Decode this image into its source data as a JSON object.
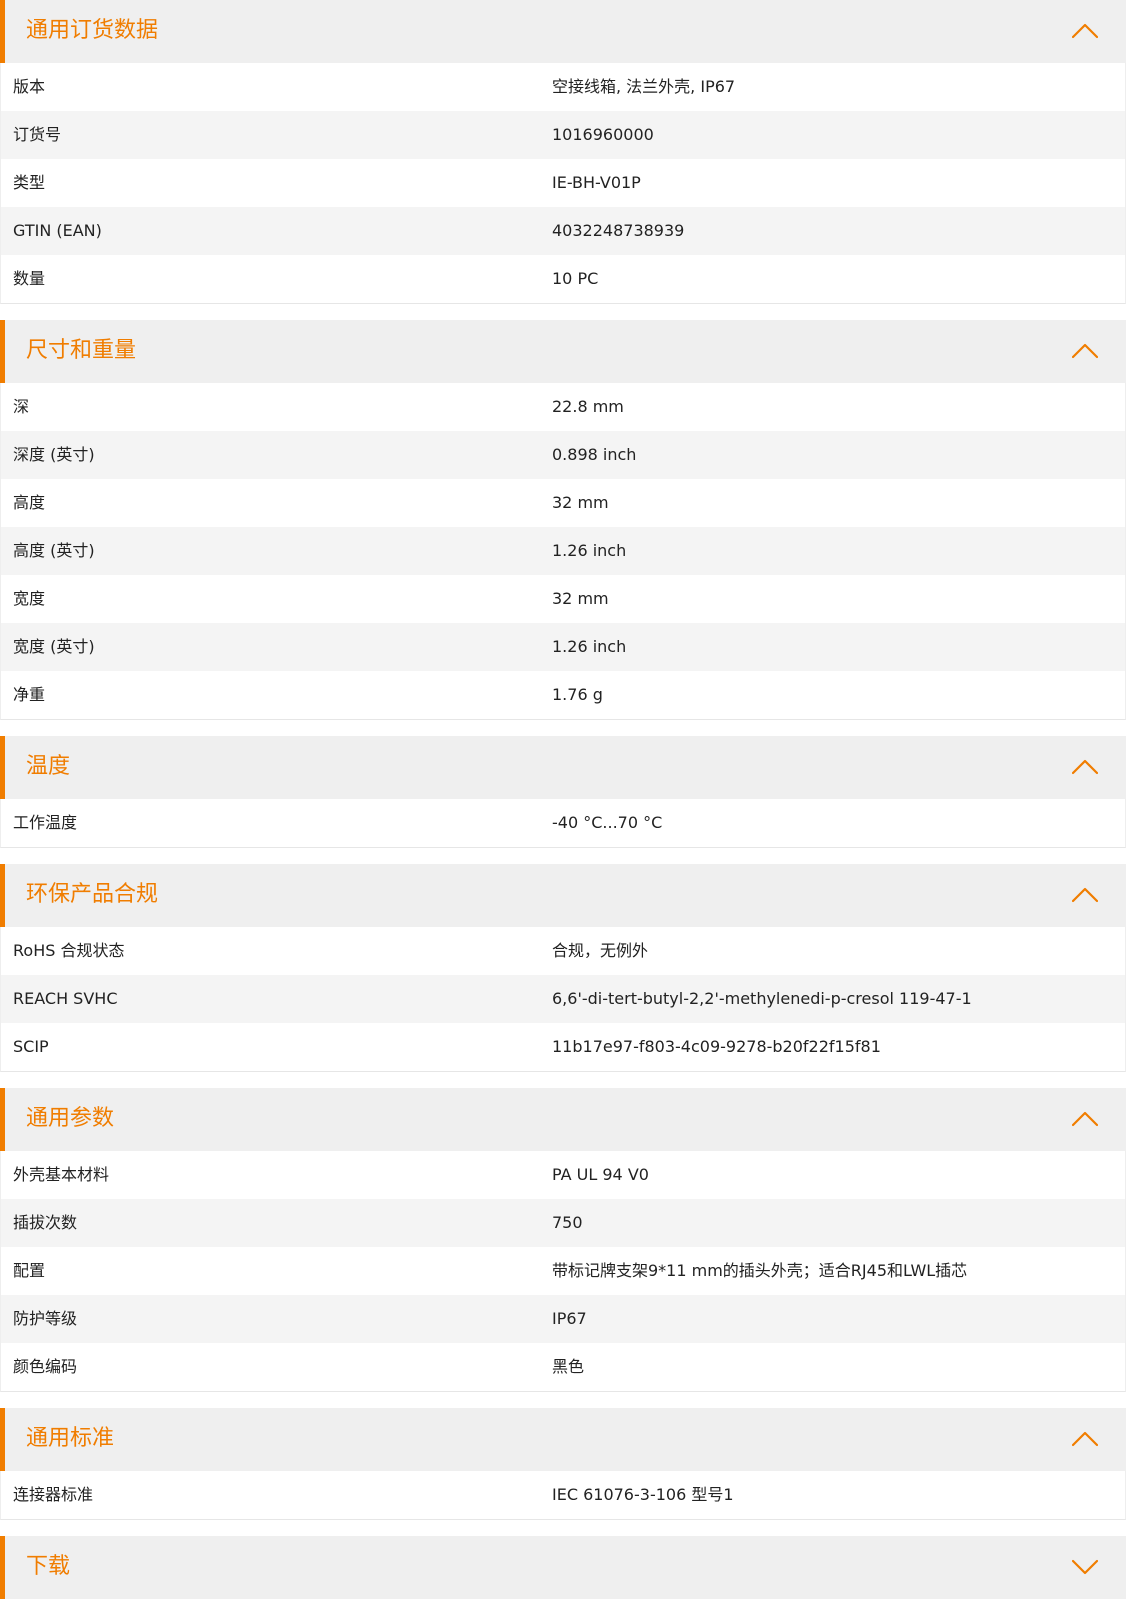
{
  "sections": [
    {
      "title": "通用订货数据",
      "rows": [
        {
          "label": "版本",
          "value": "空接线箱, 法兰外壳, IP67"
        },
        {
          "label": "订货号",
          "value": "1016960000"
        },
        {
          "label": "类型",
          "value": "IE-BH-V01P"
        },
        {
          "label": "GTIN (EAN)",
          "value": "4032248738939"
        },
        {
          "label": "数量",
          "value": "10  PC"
        }
      ]
    },
    {
      "title": "尺寸和重量",
      "rows": [
        {
          "label": "深",
          "value": "22.8  mm"
        },
        {
          "label": "深度 (英寸)",
          "value": "0.898  inch"
        },
        {
          "label": "高度",
          "value": "32  mm"
        },
        {
          "label": "高度 (英寸)",
          "value": "1.26  inch"
        },
        {
          "label": "宽度",
          "value": "32  mm"
        },
        {
          "label": "宽度 (英寸)",
          "value": "1.26  inch"
        },
        {
          "label": "净重",
          "value": "1.76  g"
        }
      ]
    },
    {
      "title": "温度",
      "rows": [
        {
          "label": "工作温度",
          "value": "-40 °C...70 °C"
        }
      ]
    },
    {
      "title": "环保产品合规",
      "rows": [
        {
          "label": "RoHS 合规状态",
          "value": "合规，无例外"
        },
        {
          "label": "REACH SVHC",
          "value": "6,6'-di-tert-butyl-2,2'-methylenedi-p-cresol 119-47-1"
        },
        {
          "label": "SCIP",
          "value": "11b17e97-f803-4c09-9278-b20f22f15f81"
        }
      ]
    },
    {
      "title": "通用参数",
      "rows": [
        {
          "label": "外壳基本材料",
          "value": "PA UL 94 V0"
        },
        {
          "label": "插拔次数",
          "value": "750"
        },
        {
          "label": "配置",
          "value": "带标记牌支架9*11 mm的插头外壳；适合RJ45和LWL插芯"
        },
        {
          "label": "防护等级",
          "value": "IP67"
        },
        {
          "label": "颜色编码",
          "value": "黑色"
        }
      ]
    },
    {
      "title": "通用标准",
      "rows": [
        {
          "label": "连接器标准",
          "value": "IEC 61076-3-106 型号1"
        }
      ]
    }
  ],
  "partial_section": {
    "title": "下载"
  },
  "colors": {
    "accent": "#f07d00",
    "header_bg": "#efefef",
    "row_alt_bg": "#f4f4f4",
    "text": "#222222"
  },
  "icons": {
    "collapse": "chevron-up-icon"
  }
}
